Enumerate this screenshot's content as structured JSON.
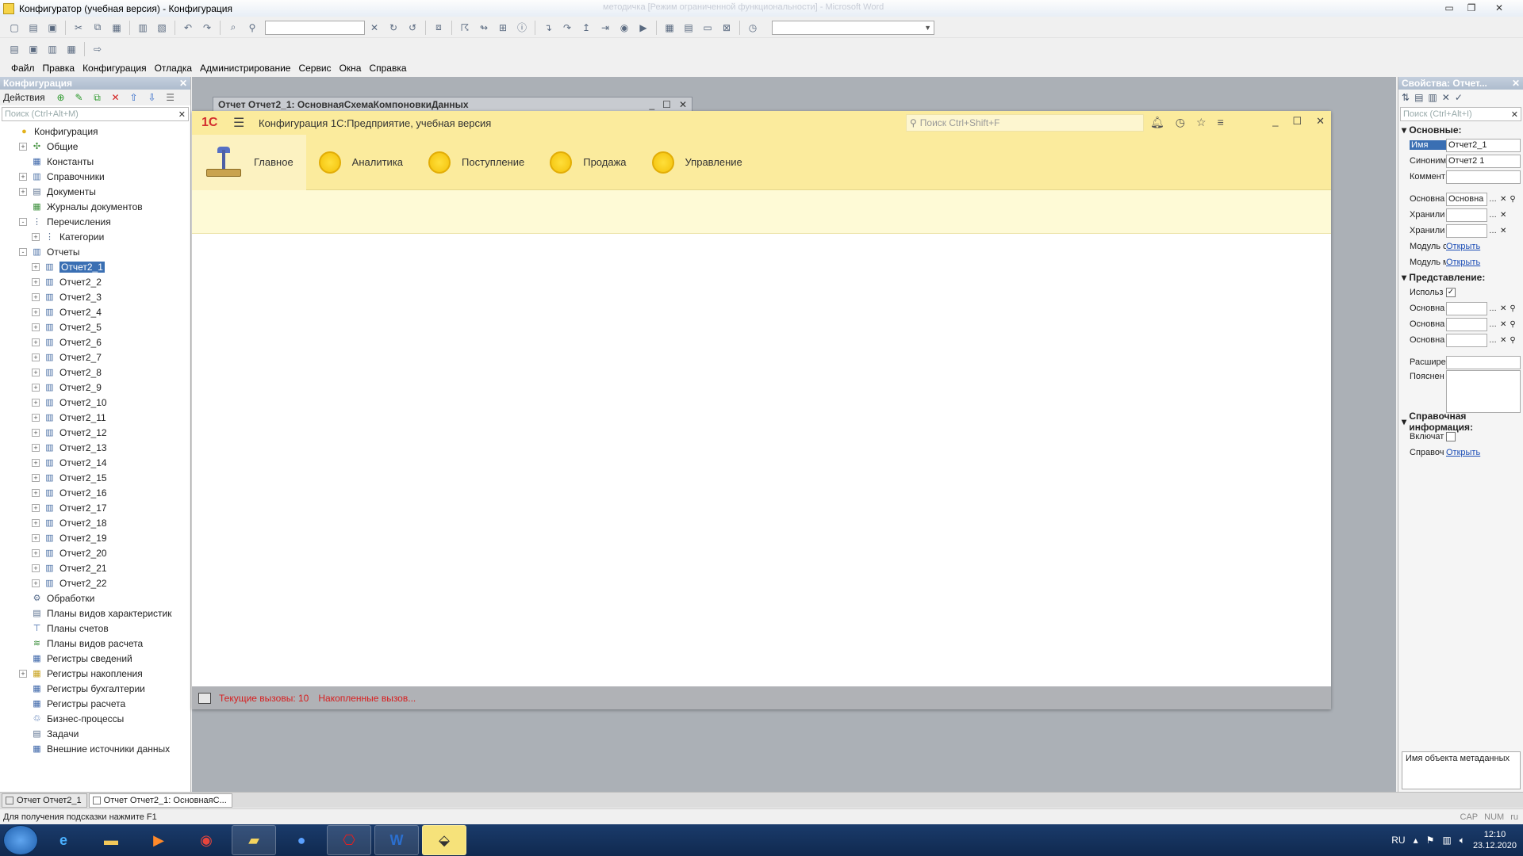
{
  "window": {
    "title": "Конфигуратор (учебная версия) - Конфигурация",
    "ghost_title": "методичка [Режим ограниченной функциональности] - Microsoft Word"
  },
  "menu": [
    "Файл",
    "Правка",
    "Конфигурация",
    "Отладка",
    "Администрирование",
    "Сервис",
    "Окна",
    "Справка"
  ],
  "left": {
    "header": "Конфигурация",
    "actions_label": "Действия",
    "search_placeholder": "Поиск (Ctrl+Alt+M)",
    "tree": [
      {
        "label": "Конфигурация",
        "level": 0,
        "exp": "",
        "icon": "config-icon"
      },
      {
        "label": "Общие",
        "level": 1,
        "exp": "+",
        "icon": "common-icon"
      },
      {
        "label": "Константы",
        "level": 1,
        "exp": "",
        "icon": "constants-icon"
      },
      {
        "label": "Справочники",
        "level": 1,
        "exp": "+",
        "icon": "catalogs-icon"
      },
      {
        "label": "Документы",
        "level": 1,
        "exp": "+",
        "icon": "documents-icon"
      },
      {
        "label": "Журналы документов",
        "level": 1,
        "exp": "",
        "icon": "journals-icon"
      },
      {
        "label": "Перечисления",
        "level": 1,
        "exp": "-",
        "icon": "enums-icon"
      },
      {
        "label": "Категории",
        "level": 2,
        "exp": "+",
        "icon": "enum-item-icon"
      },
      {
        "label": "Отчеты",
        "level": 1,
        "exp": "-",
        "icon": "reports-icon"
      },
      {
        "label": "Отчет2_1",
        "level": 2,
        "exp": "+",
        "icon": "report-icon",
        "selected": true
      },
      {
        "label": "Отчет2_2",
        "level": 2,
        "exp": "+",
        "icon": "report-icon"
      },
      {
        "label": "Отчет2_3",
        "level": 2,
        "exp": "+",
        "icon": "report-icon"
      },
      {
        "label": "Отчет2_4",
        "level": 2,
        "exp": "+",
        "icon": "report-icon"
      },
      {
        "label": "Отчет2_5",
        "level": 2,
        "exp": "+",
        "icon": "report-icon"
      },
      {
        "label": "Отчет2_6",
        "level": 2,
        "exp": "+",
        "icon": "report-icon"
      },
      {
        "label": "Отчет2_7",
        "level": 2,
        "exp": "+",
        "icon": "report-icon"
      },
      {
        "label": "Отчет2_8",
        "level": 2,
        "exp": "+",
        "icon": "report-icon"
      },
      {
        "label": "Отчет2_9",
        "level": 2,
        "exp": "+",
        "icon": "report-icon"
      },
      {
        "label": "Отчет2_10",
        "level": 2,
        "exp": "+",
        "icon": "report-icon"
      },
      {
        "label": "Отчет2_11",
        "level": 2,
        "exp": "+",
        "icon": "report-icon"
      },
      {
        "label": "Отчет2_12",
        "level": 2,
        "exp": "+",
        "icon": "report-icon"
      },
      {
        "label": "Отчет2_13",
        "level": 2,
        "exp": "+",
        "icon": "report-icon"
      },
      {
        "label": "Отчет2_14",
        "level": 2,
        "exp": "+",
        "icon": "report-icon"
      },
      {
        "label": "Отчет2_15",
        "level": 2,
        "exp": "+",
        "icon": "report-icon"
      },
      {
        "label": "Отчет2_16",
        "level": 2,
        "exp": "+",
        "icon": "report-icon"
      },
      {
        "label": "Отчет2_17",
        "level": 2,
        "exp": "+",
        "icon": "report-icon"
      },
      {
        "label": "Отчет2_18",
        "level": 2,
        "exp": "+",
        "icon": "report-icon"
      },
      {
        "label": "Отчет2_19",
        "level": 2,
        "exp": "+",
        "icon": "report-icon"
      },
      {
        "label": "Отчет2_20",
        "level": 2,
        "exp": "+",
        "icon": "report-icon"
      },
      {
        "label": "Отчет2_21",
        "level": 2,
        "exp": "+",
        "icon": "report-icon"
      },
      {
        "label": "Отчет2_22",
        "level": 2,
        "exp": "+",
        "icon": "report-icon"
      },
      {
        "label": "Обработки",
        "level": 1,
        "exp": "",
        "icon": "dataprocessors-icon"
      },
      {
        "label": "Планы видов характеристик",
        "level": 1,
        "exp": "",
        "icon": "chart-of-characteristics-icon"
      },
      {
        "label": "Планы счетов",
        "level": 1,
        "exp": "",
        "icon": "chart-of-accounts-icon"
      },
      {
        "label": "Планы видов расчета",
        "level": 1,
        "exp": "",
        "icon": "chart-of-calculation-icon"
      },
      {
        "label": "Регистры сведений",
        "level": 1,
        "exp": "",
        "icon": "info-registers-icon"
      },
      {
        "label": "Регистры накопления",
        "level": 1,
        "exp": "+",
        "icon": "accum-registers-icon"
      },
      {
        "label": "Регистры бухгалтерии",
        "level": 1,
        "exp": "",
        "icon": "accounting-registers-icon"
      },
      {
        "label": "Регистры расчета",
        "level": 1,
        "exp": "",
        "icon": "calc-registers-icon"
      },
      {
        "label": "Бизнес-процессы",
        "level": 1,
        "exp": "",
        "icon": "business-process-icon"
      },
      {
        "label": "Задачи",
        "level": 1,
        "exp": "",
        "icon": "tasks-icon"
      },
      {
        "label": "Внешние источники данных",
        "level": 1,
        "exp": "",
        "icon": "external-sources-icon"
      }
    ]
  },
  "bg_doc": {
    "title": "Отчет Отчет2_1: ОсновнаяСхемаКомпоновкиДанных"
  },
  "enterprise": {
    "logo": "1С",
    "title": "Конфигурация 1С:Предприятие, учебная версия",
    "search_placeholder": "Поиск Ctrl+Shift+F",
    "sections": [
      {
        "label": "Главное",
        "active": true
      },
      {
        "label": "Аналитика"
      },
      {
        "label": "Поступление"
      },
      {
        "label": "Продажа"
      },
      {
        "label": "Управление"
      }
    ],
    "perf_current": "Текущие вызовы: 10",
    "perf_accum": "Накопленные вызов..."
  },
  "props": {
    "header": "Свойства: Отчет...",
    "search_placeholder": "Поиск (Ctrl+Alt+I)",
    "group_main": "Основные:",
    "group_view": "Представление:",
    "group_help": "Справочная информация:",
    "name_key": "Имя",
    "name_val": "Отчет2_1",
    "synonym_key": "Синоним",
    "synonym_val": "Отчет2 1",
    "comment_key": "Коммент",
    "main_schema_key": "Основна",
    "main_schema_val": "Основна",
    "store1_key": "Хранили",
    "store2_key": "Хранили",
    "module1_key": "Модуль о",
    "module2_key": "Модуль м",
    "open_link": "Открыть",
    "use_key": "Использ",
    "view1_key": "Основна",
    "view2_key": "Основна",
    "view3_key": "Основна",
    "ext_key": "Расшире",
    "expl_key": "Пояснен",
    "include_key": "Включат",
    "help_key": "Справоч",
    "description": "Имя объекта метаданных"
  },
  "wintabs": [
    {
      "label": "Отчет Отчет2_1",
      "active": false
    },
    {
      "label": "Отчет Отчет2_1: ОсновнаяС...",
      "active": true
    }
  ],
  "status": {
    "hint": "Для получения подсказки нажмите F1",
    "caps": "CAP",
    "num": "NUM",
    "lang": "ru"
  },
  "taskbar": {
    "lang": "RU",
    "time": "12:10",
    "date": "23.12.2020"
  }
}
